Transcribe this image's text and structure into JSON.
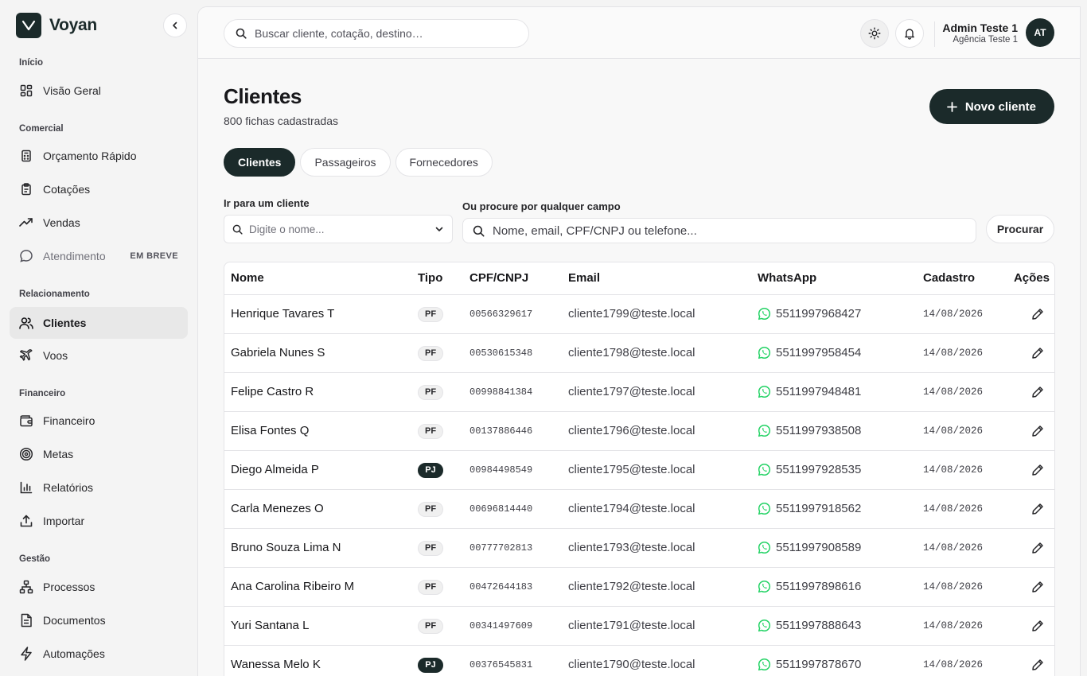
{
  "brand": {
    "name": "Voyan"
  },
  "sidebar": {
    "sections": {
      "inicio": "Início",
      "comercial": "Comercial",
      "relacionamento": "Relacionamento",
      "financeiro": "Financeiro",
      "gestao": "Gestão"
    },
    "items": {
      "visao_geral": "Visão Geral",
      "orcamento": "Orçamento Rápido",
      "cotacoes": "Cotações",
      "vendas": "Vendas",
      "atendimento": "Atendimento",
      "atendimento_badge": "EM BREVE",
      "clientes": "Clientes",
      "voos": "Voos",
      "financeiro": "Financeiro",
      "metas": "Metas",
      "relatorios": "Relatórios",
      "importar": "Importar",
      "processos": "Processos",
      "documentos": "Documentos",
      "automacoes": "Automações"
    }
  },
  "topbar": {
    "search_placeholder": "Buscar cliente, cotação, destino…",
    "user_name": "Admin Teste 1",
    "user_agency": "Agência Teste 1",
    "user_initials": "AT"
  },
  "page": {
    "title": "Clientes",
    "subtitle": "800 fichas cadastradas",
    "new_button": "Novo cliente"
  },
  "tabs": [
    "Clientes",
    "Passageiros",
    "Fornecedores"
  ],
  "filters": {
    "goto_label": "Ir para um cliente",
    "goto_placeholder": "Digite o nome...",
    "search_label": "Ou procure por qualquer campo",
    "search_placeholder": "Nome, email, CPF/CNPJ ou telefone...",
    "search_button": "Procurar"
  },
  "table": {
    "headers": {
      "nome": "Nome",
      "tipo": "Tipo",
      "doc": "CPF/CNPJ",
      "email": "Email",
      "whatsapp": "WhatsApp",
      "cadastro": "Cadastro",
      "acoes": "Ações"
    },
    "rows": [
      {
        "nome": "Henrique Tavares T",
        "tipo": "PF",
        "doc": "00566329617",
        "email": "cliente1799@teste.local",
        "whatsapp": "5511997968427",
        "cadastro": "14/08/2026"
      },
      {
        "nome": "Gabriela Nunes S",
        "tipo": "PF",
        "doc": "00530615348",
        "email": "cliente1798@teste.local",
        "whatsapp": "5511997958454",
        "cadastro": "14/08/2026"
      },
      {
        "nome": "Felipe Castro R",
        "tipo": "PF",
        "doc": "00998841384",
        "email": "cliente1797@teste.local",
        "whatsapp": "5511997948481",
        "cadastro": "14/08/2026"
      },
      {
        "nome": "Elisa Fontes Q",
        "tipo": "PF",
        "doc": "00137886446",
        "email": "cliente1796@teste.local",
        "whatsapp": "5511997938508",
        "cadastro": "14/08/2026"
      },
      {
        "nome": "Diego Almeida P",
        "tipo": "PJ",
        "doc": "00984498549",
        "email": "cliente1795@teste.local",
        "whatsapp": "5511997928535",
        "cadastro": "14/08/2026"
      },
      {
        "nome": "Carla Menezes O",
        "tipo": "PF",
        "doc": "00696814440",
        "email": "cliente1794@teste.local",
        "whatsapp": "5511997918562",
        "cadastro": "14/08/2026"
      },
      {
        "nome": "Bruno Souza Lima N",
        "tipo": "PF",
        "doc": "00777702813",
        "email": "cliente1793@teste.local",
        "whatsapp": "5511997908589",
        "cadastro": "14/08/2026"
      },
      {
        "nome": "Ana Carolina Ribeiro M",
        "tipo": "PF",
        "doc": "00472644183",
        "email": "cliente1792@teste.local",
        "whatsapp": "5511997898616",
        "cadastro": "14/08/2026"
      },
      {
        "nome": "Yuri Santana L",
        "tipo": "PF",
        "doc": "00341497609",
        "email": "cliente1791@teste.local",
        "whatsapp": "5511997888643",
        "cadastro": "14/08/2026"
      },
      {
        "nome": "Wanessa Melo K",
        "tipo": "PJ",
        "doc": "00376545831",
        "email": "cliente1790@teste.local",
        "whatsapp": "5511997878670",
        "cadastro": "14/08/2026"
      }
    ]
  },
  "colors": {
    "brand": "#1b2a2a",
    "whatsapp": "#25d366"
  }
}
